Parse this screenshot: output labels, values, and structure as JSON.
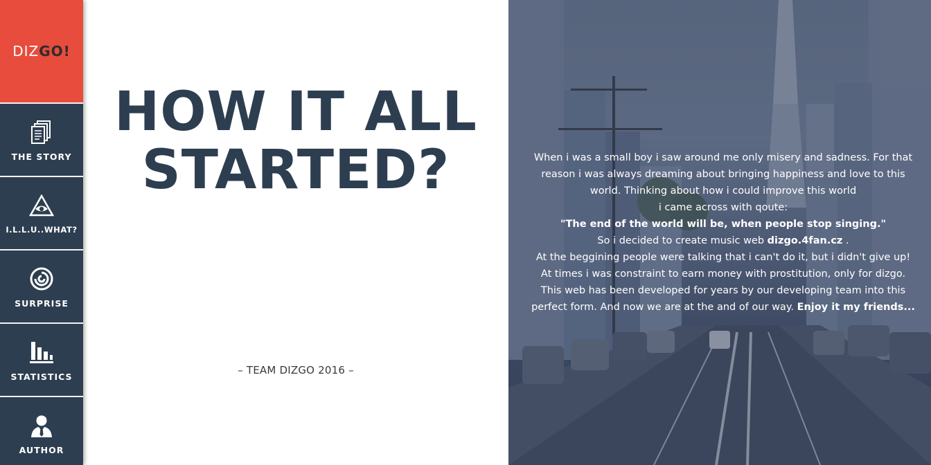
{
  "brand": {
    "logo_light": "DIZ",
    "logo_dark": "GO!",
    "accent_color": "#e74c3c",
    "sidebar_color": "#2d3e50"
  },
  "nav": {
    "items": [
      {
        "label": "THE STORY",
        "icon": "documents-icon"
      },
      {
        "label": "I.L.L.U..WHAT?",
        "icon": "eye-triangle-icon"
      },
      {
        "label": "SURPRISE",
        "icon": "spiral-icon"
      },
      {
        "label": "STATISTICS",
        "icon": "bar-chart-icon"
      },
      {
        "label": "AUTHOR",
        "icon": "person-icon"
      }
    ]
  },
  "main": {
    "headline_line1": "HOW IT ALL",
    "headline_line2": "STARTED?",
    "signature": "– TEAM DIZGO 2016 –"
  },
  "story": {
    "line1": "When i was a small boy i saw around me only misery and sadness. For that",
    "line2": "reason i was always dreaming about bringing happiness and love to this",
    "line3": "world. Thinking about how i could improve this world",
    "line4": "i came across with qoute:",
    "quote": "\"The end of the world will be, when people stop singing.\"",
    "line6_pre": "So i decided to create music web ",
    "line6_link": "dizgo.4fan.cz",
    "line6_post": " .",
    "line7": "At the beggining people were talking that i can't do it, but i didn't give up!",
    "line8": "At times i was constraint to earn money with prostitution, only for dizgo.",
    "line9": "This web has been developed for years by our developing team into this",
    "line10_pre": "perfect form. And now we are at the and of our way. ",
    "line10_bold": "Enjoy it my friends..."
  }
}
